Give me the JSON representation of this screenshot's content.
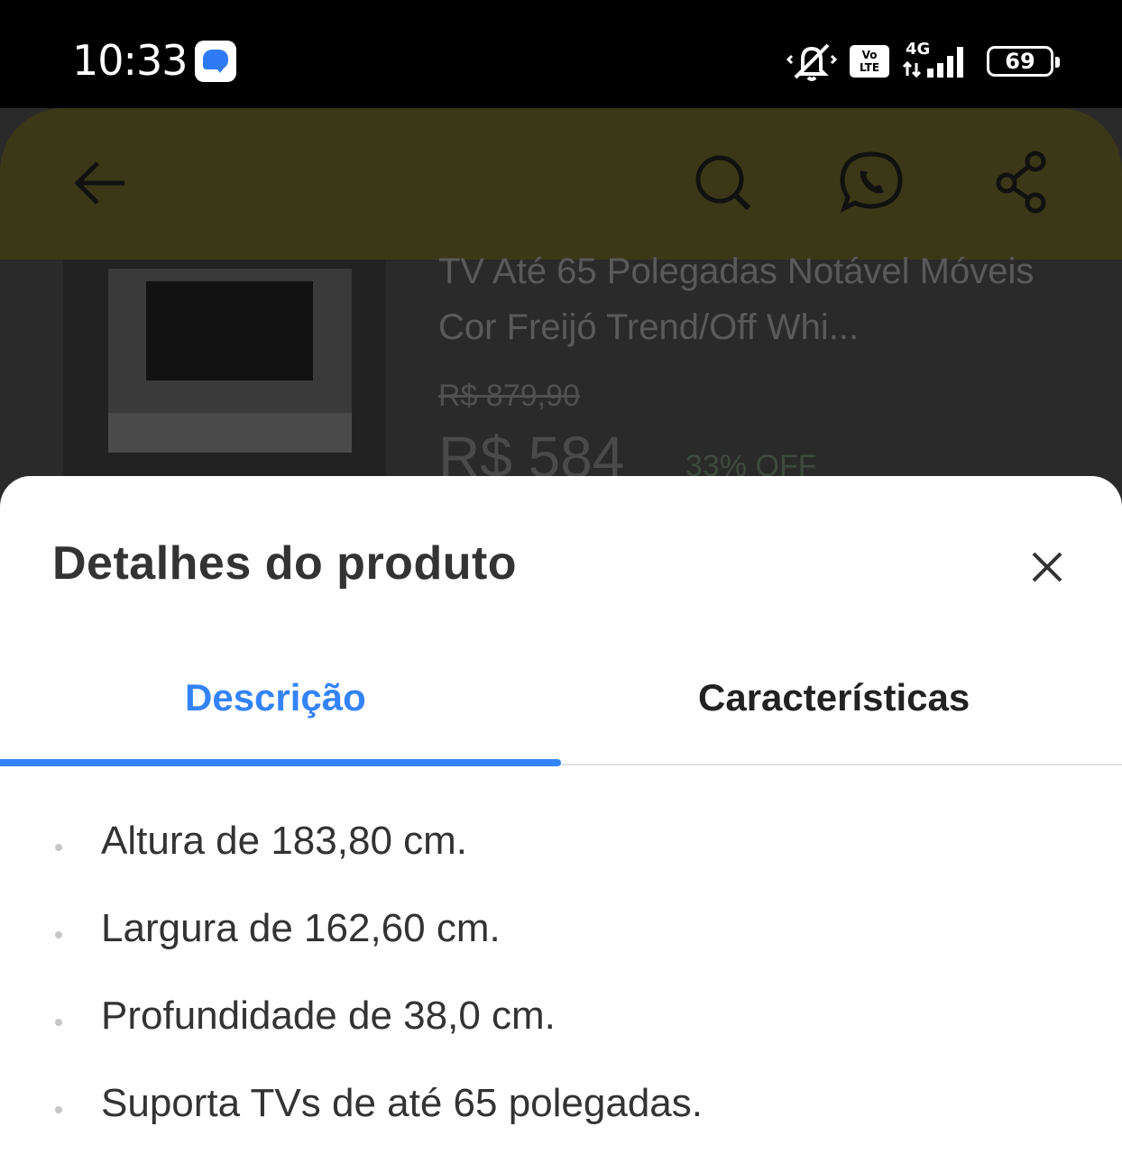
{
  "status_bar": {
    "time": "10:33",
    "volte_label": "Vo\nLTE",
    "network_label": "4G",
    "battery": "69",
    "icons": [
      "messages-icon",
      "mute-icon",
      "volte-icon",
      "signal-icon",
      "battery-icon"
    ]
  },
  "background_page": {
    "header_icons": [
      "back-arrow-icon",
      "search-icon",
      "whatsapp-icon",
      "share-icon"
    ],
    "product_title": "TV Até 65 Polegadas Notável Móveis Cor Freijó Trend/Off Whi...",
    "old_price": "R$ 879,90",
    "new_price": "R$ 584",
    "discount": "33% OFF"
  },
  "sheet": {
    "title": "Detalhes do produto",
    "tabs": [
      {
        "label": "Descrição",
        "selected": true
      },
      {
        "label": "Características",
        "selected": false
      }
    ],
    "description_items": [
      "Altura de 183,80 cm.",
      "Largura de 162,60 cm.",
      "Profundidade de 38,0 cm.",
      "Suporta TVs de até 65 polegadas."
    ]
  },
  "colors": {
    "accent": "#3483fa",
    "header_dimmed": "#3b3817",
    "text_primary": "#333333"
  }
}
